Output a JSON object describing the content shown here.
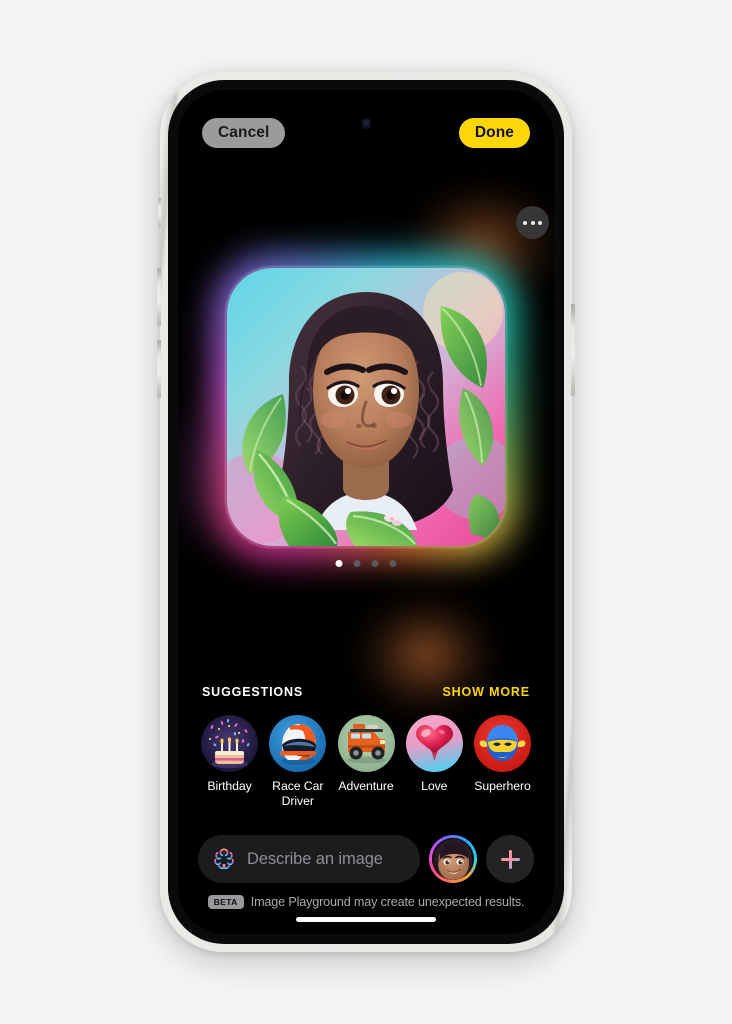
{
  "app": {
    "name": "Image Playground",
    "accent_yellow": "#ffd60a",
    "screen_background": "#000000",
    "page_background": "#f5f5f5"
  },
  "topbar": {
    "cancel_label": "Cancel",
    "done_label": "Done"
  },
  "preview": {
    "more_icon": "ellipsis-icon",
    "dots_total": 4,
    "dots_active_index": 0,
    "description": "Generated cartoon portrait of a smiling girl with curly dark hair surrounded by green leaves"
  },
  "suggestions": {
    "title": "SUGGESTIONS",
    "show_more_label": "SHOW MORE",
    "items": [
      {
        "label": "Birthday",
        "icon": "birthday-cake-icon"
      },
      {
        "label": "Race Car Driver",
        "icon": "racing-helmet-icon"
      },
      {
        "label": "Adventure",
        "icon": "offroad-truck-icon"
      },
      {
        "label": "Love",
        "icon": "heart-balloon-icon"
      },
      {
        "label": "Superhero",
        "icon": "superhero-mask-icon"
      }
    ]
  },
  "input": {
    "leading_icon": "image-playground-icon",
    "placeholder": "Describe an image",
    "value": "",
    "avatar_icon": "person-avatar",
    "add_icon": "plus-icon"
  },
  "footer": {
    "badge": "BETA",
    "text": "Image Playground may create unexpected results."
  }
}
